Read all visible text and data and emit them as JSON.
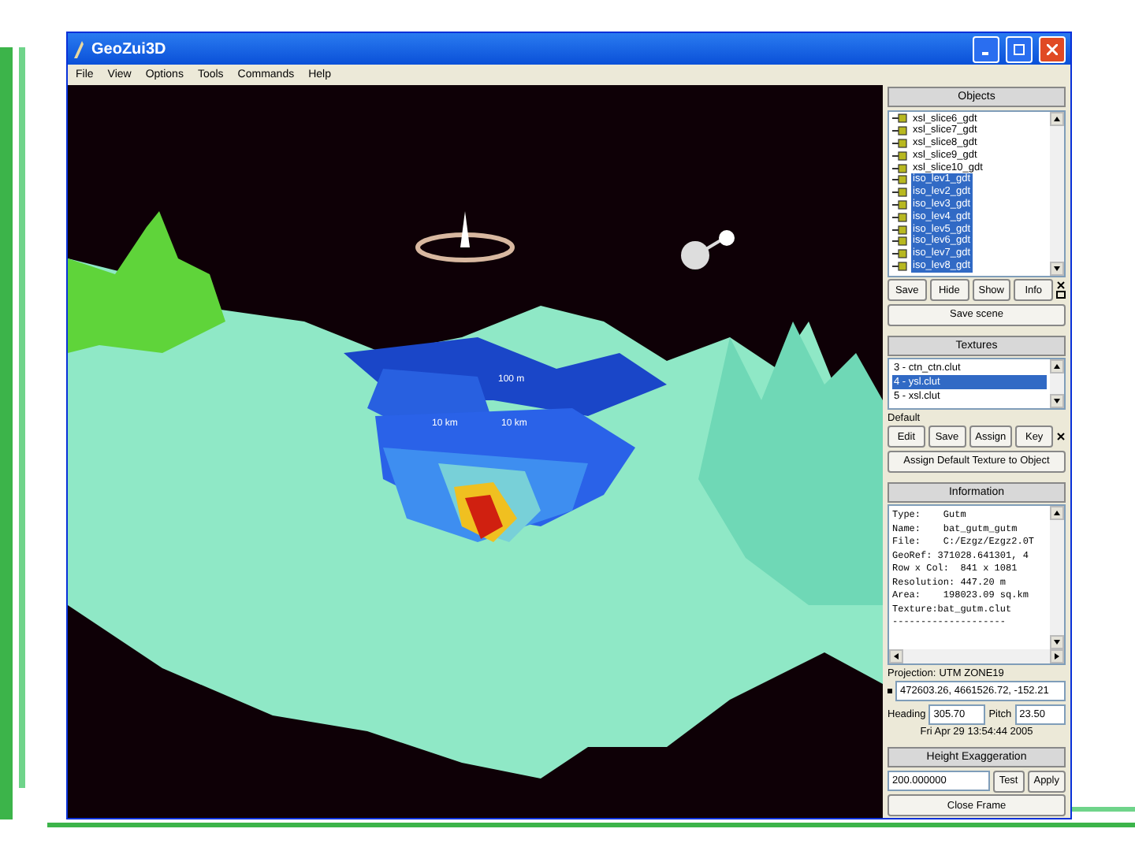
{
  "window": {
    "title": "GeoZui3D"
  },
  "menu": [
    "File",
    "View",
    "Options",
    "Tools",
    "Commands",
    "Help"
  ],
  "scene": {
    "labels": [
      "100 m",
      "10 km",
      "10 km"
    ]
  },
  "objects": {
    "title": "Objects",
    "items": [
      {
        "label": "xsl_slice6_gdt",
        "selected": false
      },
      {
        "label": "xsl_slice7_gdt",
        "selected": false
      },
      {
        "label": "xsl_slice8_gdt",
        "selected": false
      },
      {
        "label": "xsl_slice9_gdt",
        "selected": false
      },
      {
        "label": "xsl_slice10_gdt",
        "selected": false
      },
      {
        "label": "iso_lev1_gdt",
        "selected": true
      },
      {
        "label": "iso_lev2_gdt",
        "selected": true
      },
      {
        "label": "iso_lev3_gdt",
        "selected": true
      },
      {
        "label": "iso_lev4_gdt",
        "selected": true
      },
      {
        "label": "iso_lev5_gdt",
        "selected": true
      },
      {
        "label": "iso_lev6_gdt",
        "selected": true
      },
      {
        "label": "iso_lev7_gdt",
        "selected": true
      },
      {
        "label": "iso_lev8_gdt",
        "selected": true
      }
    ],
    "buttons": [
      "Save",
      "Hide",
      "Show",
      "Info"
    ],
    "save_scene": "Save scene"
  },
  "textures": {
    "title": "Textures",
    "items": [
      {
        "label": "3 - ctn_ctn.clut",
        "selected": false
      },
      {
        "label": "4 - ysl.clut",
        "selected": true
      },
      {
        "label": "5 - xsl.clut",
        "selected": false
      }
    ],
    "default_label": "Default",
    "buttons": [
      "Edit",
      "Save",
      "Assign",
      "Key"
    ],
    "assign_default": "Assign Default Texture to Object"
  },
  "information": {
    "title": "Information",
    "lines": [
      "Type:    Gutm",
      "Name:    bat_gutm_gutm",
      "File:    C:/Ezgz/Ezgz2.0T",
      "GeoRef: 371028.641301, 4",
      "Row x Col:  841 x 1081",
      "Resolution: 447.20 m",
      "Area:    198023.09 sq.km",
      "Texture:bat_gutm.clut",
      "--------------------"
    ]
  },
  "projection": {
    "label": "Projection:",
    "value": "UTM ZONE19"
  },
  "position": "472603.26, 4661526.72, -152.21",
  "heading": {
    "label": "Heading",
    "value": "305.70"
  },
  "pitch": {
    "label": "Pitch",
    "value": "23.50"
  },
  "timestamp": "Fri Apr 29 13:54:44 2005",
  "height_exaggeration": {
    "title": "Height Exaggeration",
    "value": "200.000000",
    "buttons": [
      "Test",
      "Apply"
    ]
  },
  "close_button": "Close Frame"
}
